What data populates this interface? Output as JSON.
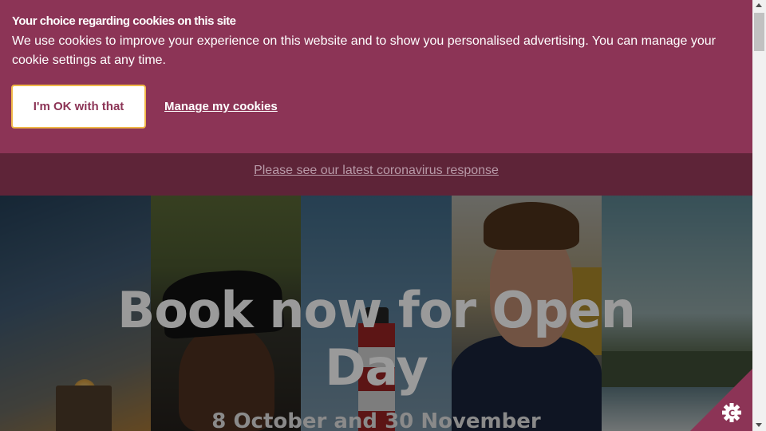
{
  "cookie_banner": {
    "title": "Your choice regarding cookies on this site",
    "text": "We use cookies to improve your experience on this website and to show you personalised advertising. You can manage your cookie settings at any time.",
    "accept_label": "I'm OK with that",
    "manage_label": "Manage my cookies"
  },
  "notice": {
    "link": "Please see our latest coronavirus response"
  },
  "hero": {
    "title_line1": "Book now for Open",
    "title_line2": "Day",
    "subtitle": "8 October and 30 November"
  },
  "icons": {
    "cookie_settings": "cookie-settings-icon"
  },
  "colors": {
    "brand": "#8c3456",
    "notice_bg": "#5e2438",
    "button_border": "#f0b848"
  }
}
